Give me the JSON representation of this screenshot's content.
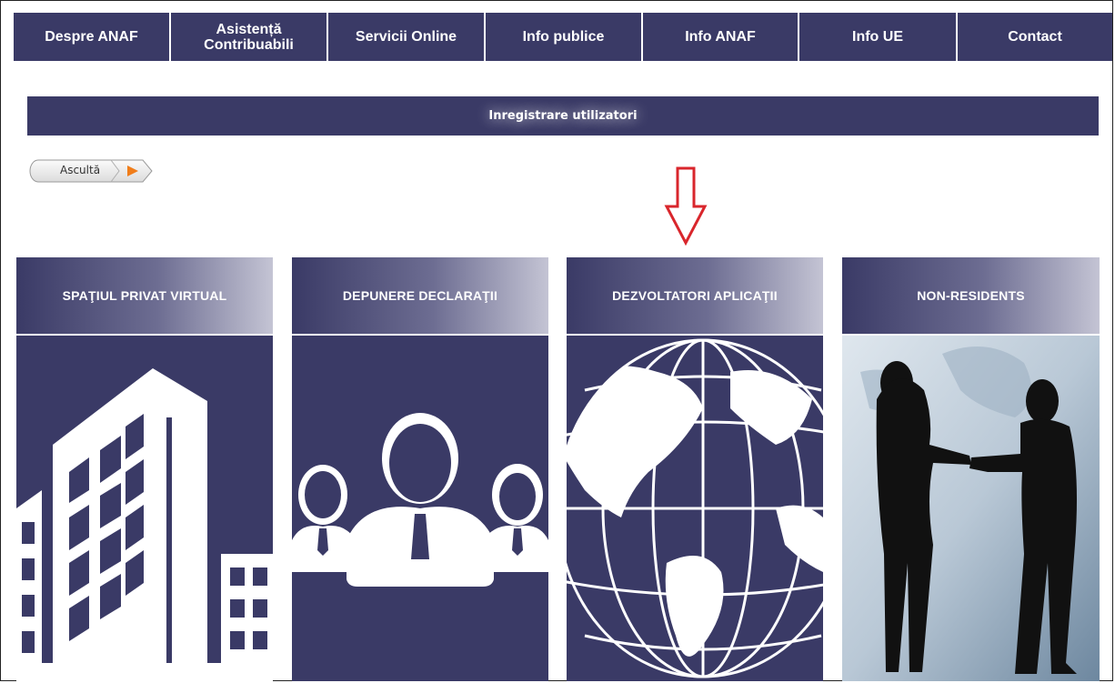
{
  "nav": {
    "items": [
      {
        "label": "Despre ANAF"
      },
      {
        "label_line1": "Asistență",
        "label_line2": "Contribuabili"
      },
      {
        "label": "Servicii Online"
      },
      {
        "label": "Info publice"
      },
      {
        "label": "Info ANAF"
      },
      {
        "label": "Info UE"
      },
      {
        "label": "Contact"
      }
    ]
  },
  "page": {
    "title": "Inregistrare utilizatori"
  },
  "listen": {
    "label": "Ascultă"
  },
  "tiles": [
    {
      "title": "SPAŢIUL PRIVAT VIRTUAL",
      "icon": "building-icon"
    },
    {
      "title": "DEPUNERE DECLARAŢII",
      "icon": "people-icon"
    },
    {
      "title": "DEZVOLTATORI APLICAŢII",
      "icon": "globe-icon"
    },
    {
      "title": "NON-RESIDENTS",
      "icon": "handshake-icon"
    }
  ],
  "colors": {
    "brand": "#3a3a66",
    "arrow": "#d9262c",
    "play": "#f07d1a"
  }
}
